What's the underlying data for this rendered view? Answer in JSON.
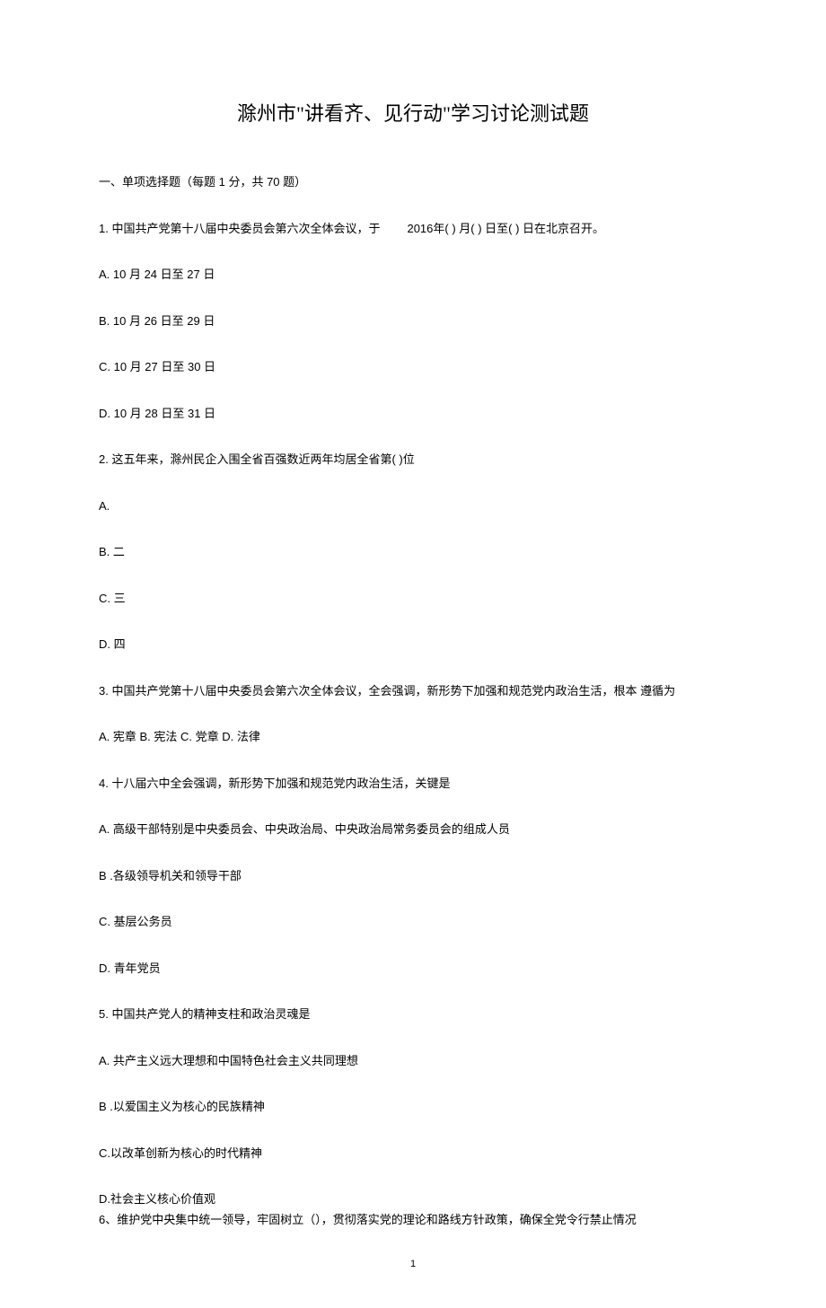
{
  "title": "滁州市\"讲看齐、见行动\"学习讨论测试题",
  "sectionHeader": "一、单项选择题（每题 1 分，共 70 题）",
  "q1": {
    "prefix": "1.  中国共产党第十八届中央委员会第六次全体会议，于",
    "suffix": "2016年( ) 月( ) 日至( ) 日在北京召开。",
    "optA": "A.  10 月 24 日至 27 日",
    "optB": "B.  10 月 26 日至 29 日",
    "optC": "C.  10 月 27 日至 30 日",
    "optD": "D.  10 月 28 日至 31 日"
  },
  "q2": {
    "text": "2.  这五年来，滁州民企入围全省百强数近两年均居全省第(   )位",
    "optA": "A.",
    "optB": "B.  二",
    "optC": "C.  三",
    "optD": "D.  四"
  },
  "q3": {
    "text": "3.  中国共产党第十八届中央委员会第六次全体会议，全会强调，新形势下加强和规范党内政治生活，根本 遵循为",
    "options": "A.  宪章  B.  宪法  C.  党章  D. 法律"
  },
  "q4": {
    "text": "4.  十八届六中全会强调，新形势下加强和规范党内政治生活，关键是",
    "optA": "A.  高级干部特别是中央委员会、中央政治局、中央政治局常务委员会的组成人员",
    "optB": "B .各级领导机关和领导干部",
    "optC": "C.  基层公务员",
    "optD": "D.  青年党员"
  },
  "q5": {
    "text": "5.  中国共产党人的精神支柱和政治灵魂是",
    "optA": "A.  共产主义远大理想和中国特色社会主义共同理想",
    "optB": "B .以爱国主义为核心的民族精神",
    "optC": "C.以改革创新为核心的时代精神",
    "optD": "D.社会主义核心价值观"
  },
  "q6": {
    "text": "6、维护党中央集中统一领导，牢固树立（），贯彻落实党的理论和路线方针政策，确保全党令行禁止情况"
  },
  "pageNumber": "1"
}
